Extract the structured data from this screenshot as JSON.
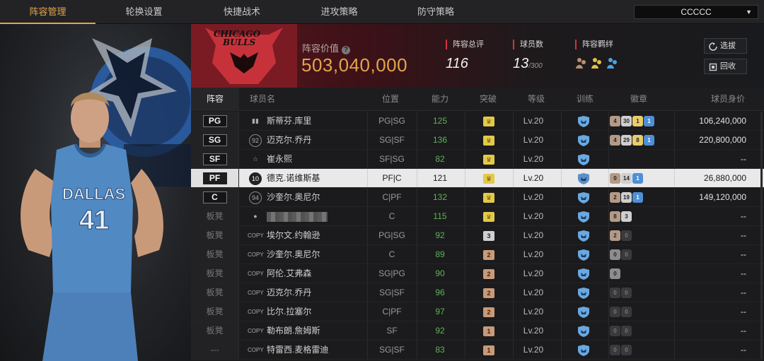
{
  "nav": {
    "tabs": [
      "阵容管理",
      "轮换设置",
      "快捷战术",
      "进攻策略",
      "防守策略"
    ],
    "active_tab": 0,
    "team_select": "CCCCC"
  },
  "banner": {
    "value_label": "阵容价值",
    "value": "503,040,000",
    "rating_label": "阵容总评",
    "rating": "116",
    "count_label": "球员数",
    "count": "13",
    "count_max": "/300",
    "bond_label": "阵容羁绊",
    "btn_pick": "选拔",
    "btn_recycle": "回收"
  },
  "table": {
    "headers": [
      "阵容",
      "球员名",
      "位置",
      "能力",
      "突破",
      "等级",
      "训练",
      "徽章",
      "球员身价"
    ],
    "rows": [
      {
        "slot": "PG",
        "num": "",
        "name": "斯蒂芬.库里",
        "pos": "PG|SG",
        "ability": "125",
        "breakthrough": "crown",
        "level": "Lv.20",
        "badges": [
          [
            "4",
            "bronze"
          ],
          [
            "30",
            "silver"
          ],
          [
            "1",
            "gold"
          ],
          [
            "1",
            "blue"
          ]
        ],
        "value": "106,240,000"
      },
      {
        "slot": "SG",
        "num": "92",
        "name": "迈克尔.乔丹",
        "pos": "SG|SF",
        "ability": "136",
        "breakthrough": "crown",
        "level": "Lv.20",
        "badges": [
          [
            "4",
            "bronze"
          ],
          [
            "29",
            "silver"
          ],
          [
            "8",
            "gold"
          ],
          [
            "1",
            "blue"
          ]
        ],
        "value": "220,800,000"
      },
      {
        "slot": "SF",
        "num": "",
        "name": "崔永熙",
        "pos": "SF|SG",
        "ability": "82",
        "breakthrough": "crown",
        "level": "Lv.20",
        "badges": [],
        "value": "--"
      },
      {
        "slot": "PF",
        "num": "10",
        "name": "德克.诺维斯基",
        "pos": "PF|C",
        "ability": "121",
        "breakthrough": "crown",
        "level": "Lv.20",
        "badges": [
          [
            "0",
            "bronze"
          ],
          [
            "14",
            "silver"
          ],
          [
            "1",
            "blue"
          ]
        ],
        "value": "26,880,000"
      },
      {
        "slot": "C",
        "num": "94",
        "name": "沙奎尔.奥尼尔",
        "pos": "C|PF",
        "ability": "132",
        "breakthrough": "crown",
        "level": "Lv.20",
        "badges": [
          [
            "2",
            "bronze"
          ],
          [
            "19",
            "silver"
          ],
          [
            "1",
            "blue"
          ]
        ],
        "value": "149,120,000"
      },
      {
        "slot": "板凳",
        "num": "",
        "name": "",
        "pos": "C",
        "ability": "115",
        "breakthrough": "crown",
        "level": "Lv.20",
        "badges": [
          [
            "8",
            "bronze"
          ],
          [
            "3",
            "silver"
          ]
        ],
        "value": "--"
      },
      {
        "slot": "板凳",
        "num": "COPY",
        "name": "埃尔文.约翰逊",
        "pos": "PG|SG",
        "ability": "92",
        "breakthrough": "3",
        "level": "Lv.20",
        "badges": [
          [
            "2",
            "bronze"
          ],
          [
            "0",
            "empty"
          ]
        ],
        "value": "--"
      },
      {
        "slot": "板凳",
        "num": "COPY",
        "name": "沙奎尔.奥尼尔",
        "pos": "C",
        "ability": "89",
        "breakthrough": "2",
        "level": "Lv.20",
        "badges": [
          [
            "0",
            "grey"
          ],
          [
            "0",
            "empty"
          ]
        ],
        "value": "--"
      },
      {
        "slot": "板凳",
        "num": "COPY",
        "name": "阿伦.艾弗森",
        "pos": "SG|PG",
        "ability": "90",
        "breakthrough": "2",
        "level": "Lv.20",
        "badges": [
          [
            "0",
            "grey"
          ]
        ],
        "value": "--"
      },
      {
        "slot": "板凳",
        "num": "COPY",
        "name": "迈克尔.乔丹",
        "pos": "SG|SF",
        "ability": "96",
        "breakthrough": "2",
        "level": "Lv.20",
        "badges": [
          [
            "0",
            "empty"
          ],
          [
            "0",
            "empty"
          ]
        ],
        "value": "--"
      },
      {
        "slot": "板凳",
        "num": "COPY",
        "name": "比尔.拉塞尔",
        "pos": "C|PF",
        "ability": "97",
        "breakthrough": "2",
        "level": "Lv.20",
        "badges": [
          [
            "0",
            "empty"
          ],
          [
            "0",
            "empty"
          ]
        ],
        "value": "--"
      },
      {
        "slot": "板凳",
        "num": "COPY",
        "name": "勒布朗.詹姆斯",
        "pos": "SF",
        "ability": "92",
        "breakthrough": "1",
        "level": "Lv.20",
        "badges": [
          [
            "0",
            "empty"
          ],
          [
            "0",
            "empty"
          ]
        ],
        "value": "--"
      },
      {
        "slot": "---",
        "num": "COPY",
        "name": "特雷西.麦格雷迪",
        "pos": "SG|SF",
        "ability": "83",
        "breakthrough": "1",
        "level": "Lv.20",
        "badges": [
          [
            "0",
            "empty"
          ],
          [
            "0",
            "empty"
          ]
        ],
        "value": "--"
      }
    ],
    "selected_row": 3
  },
  "player": {
    "jersey_team": "DALLAS",
    "jersey_number": "41"
  },
  "colors": {
    "accent": "#e3a54b",
    "green": "#5bb553",
    "red": "#d3343d"
  },
  "icons": [
    "refresh-icon",
    "recycle-icon",
    "help-icon",
    "crown-icon",
    "shield-icon",
    "chevron-down-icon"
  ]
}
